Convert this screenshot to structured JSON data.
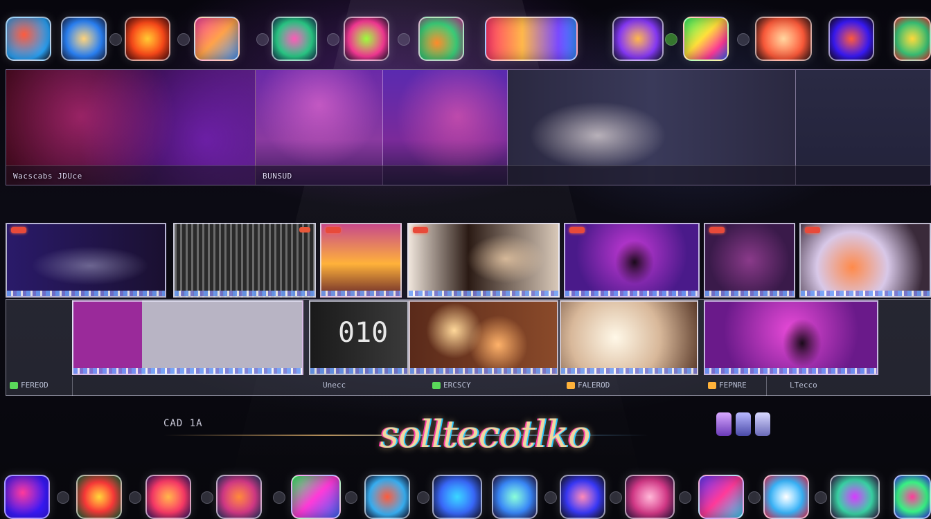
{
  "hero": {
    "caption_left": "Wacscabs JDUce",
    "caption_mid": "BUNSUD"
  },
  "clips_row2": {
    "labels": [
      "FEREOD",
      "Unecc",
      "ERCSCY",
      "FALEROD",
      "FEPNRE",
      "LTecco"
    ]
  },
  "overlay": {
    "small_text": "CAD 1A",
    "glitch_title": "solltecotlko"
  }
}
